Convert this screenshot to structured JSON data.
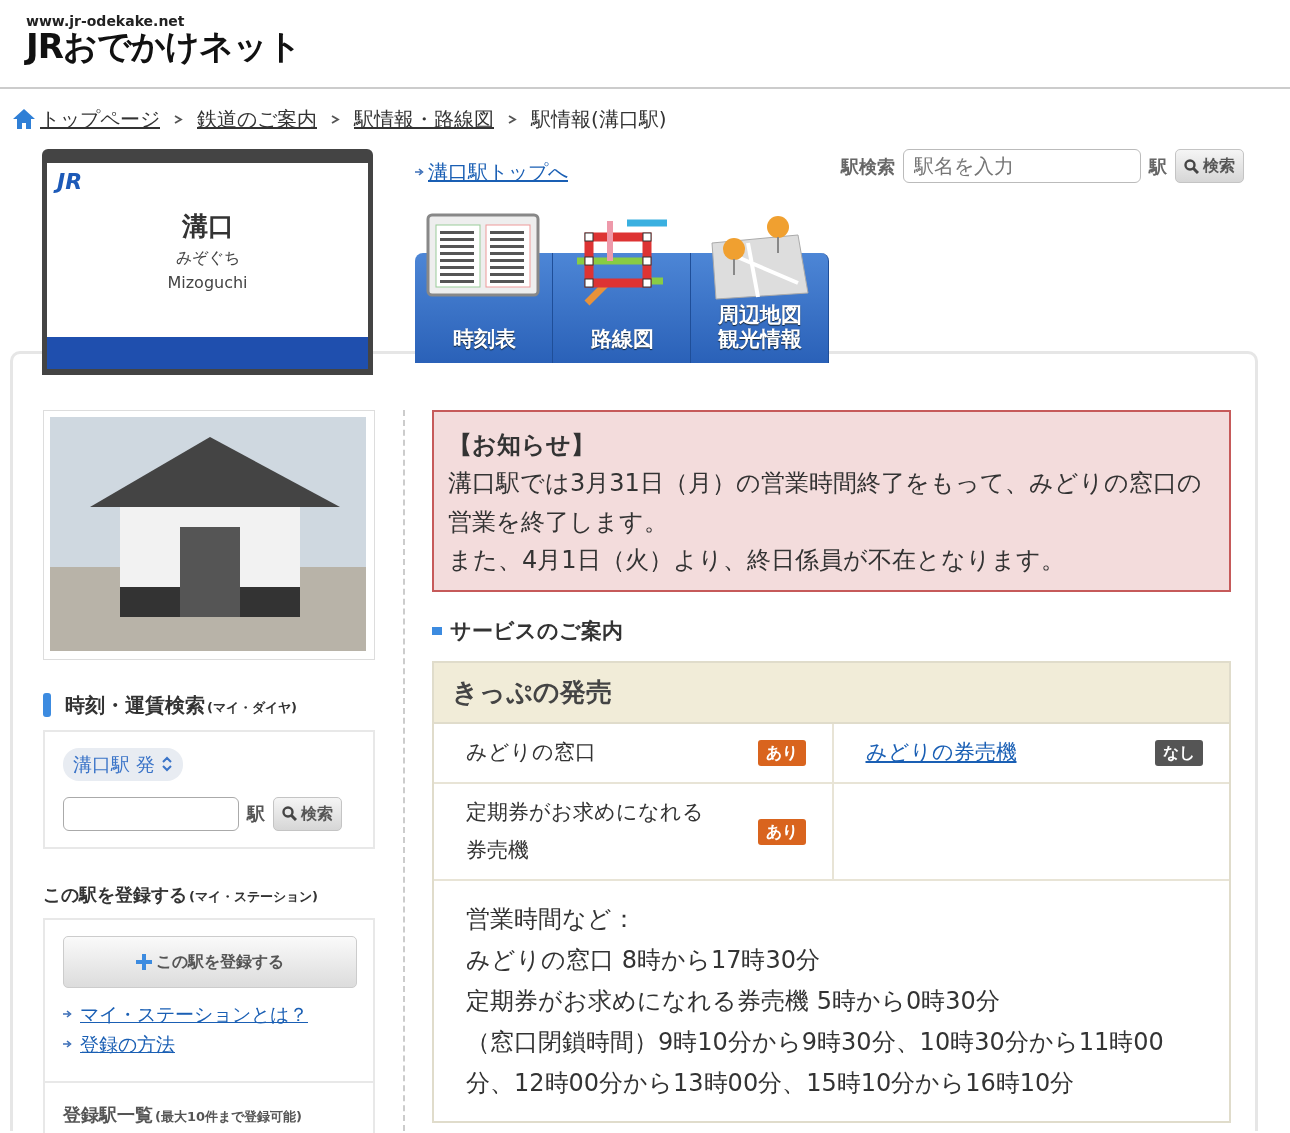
{
  "header": {
    "site_url": "www.jr-odekake.net",
    "logo_text": "JRおでかけネット"
  },
  "breadcrumb": [
    {
      "label": "トップページ",
      "link": true,
      "kind": "home"
    },
    {
      "label": "鉄道のご案内",
      "link": true,
      "kind": "page"
    },
    {
      "label": "駅情報・路線図",
      "link": true,
      "kind": "page"
    },
    {
      "label": "駅情報(溝口駅)",
      "link": false,
      "kind": "page"
    }
  ],
  "station_sign": {
    "logo": "JR",
    "name": "溝口",
    "kana": "みぞぐち",
    "romaji": "Mizoguchi"
  },
  "station_top_link": "溝口駅トップへ",
  "station_search": {
    "label": "駅検索",
    "placeholder": "駅名を入力",
    "suffix": "駅",
    "button": "検索"
  },
  "tabs": [
    {
      "kind": "timetable",
      "lines": [
        "時刻表"
      ]
    },
    {
      "kind": "route",
      "lines": [
        "路線図"
      ]
    },
    {
      "kind": "map",
      "lines": [
        "周辺地図",
        "観光情報"
      ]
    }
  ],
  "sidebar": {
    "timetable_search": {
      "title": "時刻・運賃検索",
      "note": "(マイ・ダイヤ)",
      "origin": "溝口駅 発",
      "suffix": "駅",
      "button": "検索"
    },
    "register": {
      "title": "この駅を登録する",
      "note": "(マイ・ステーション)",
      "button": "この駅を登録する",
      "links": [
        "マイ・ステーションとは？",
        "登録の方法"
      ],
      "list_title": "登録駅一覧",
      "list_note": "(最大10件まで登録可能)"
    }
  },
  "notice": {
    "title": "【お知らせ】",
    "lines": [
      "溝口駅では3月31日（月）の営業時間終了をもって、みどりの窓口の営業を終了します。",
      "また、4月1日（火）より、終日係員が不在となります。"
    ]
  },
  "services": {
    "heading": "サービスのご案内",
    "section_title": "きっぷの発売",
    "items": [
      {
        "label": "みどりの窓口",
        "link": false,
        "status": "あり",
        "available": true
      },
      {
        "label": "みどりの券売機",
        "link": true,
        "status": "なし",
        "available": false
      },
      {
        "label": "定期券がお求めになれる券売機",
        "link": false,
        "status": "あり",
        "available": true
      }
    ],
    "hours": {
      "title": "営業時間など：",
      "lines": [
        "みどりの窓口 8時から17時30分",
        "定期券がお求めになれる券売機 5時から0時30分",
        "（窓口閉鎖時間）9時10分から9時30分、10時30分から11時00分、12時00分から13時00分、15時10分から16時10分"
      ]
    }
  }
}
